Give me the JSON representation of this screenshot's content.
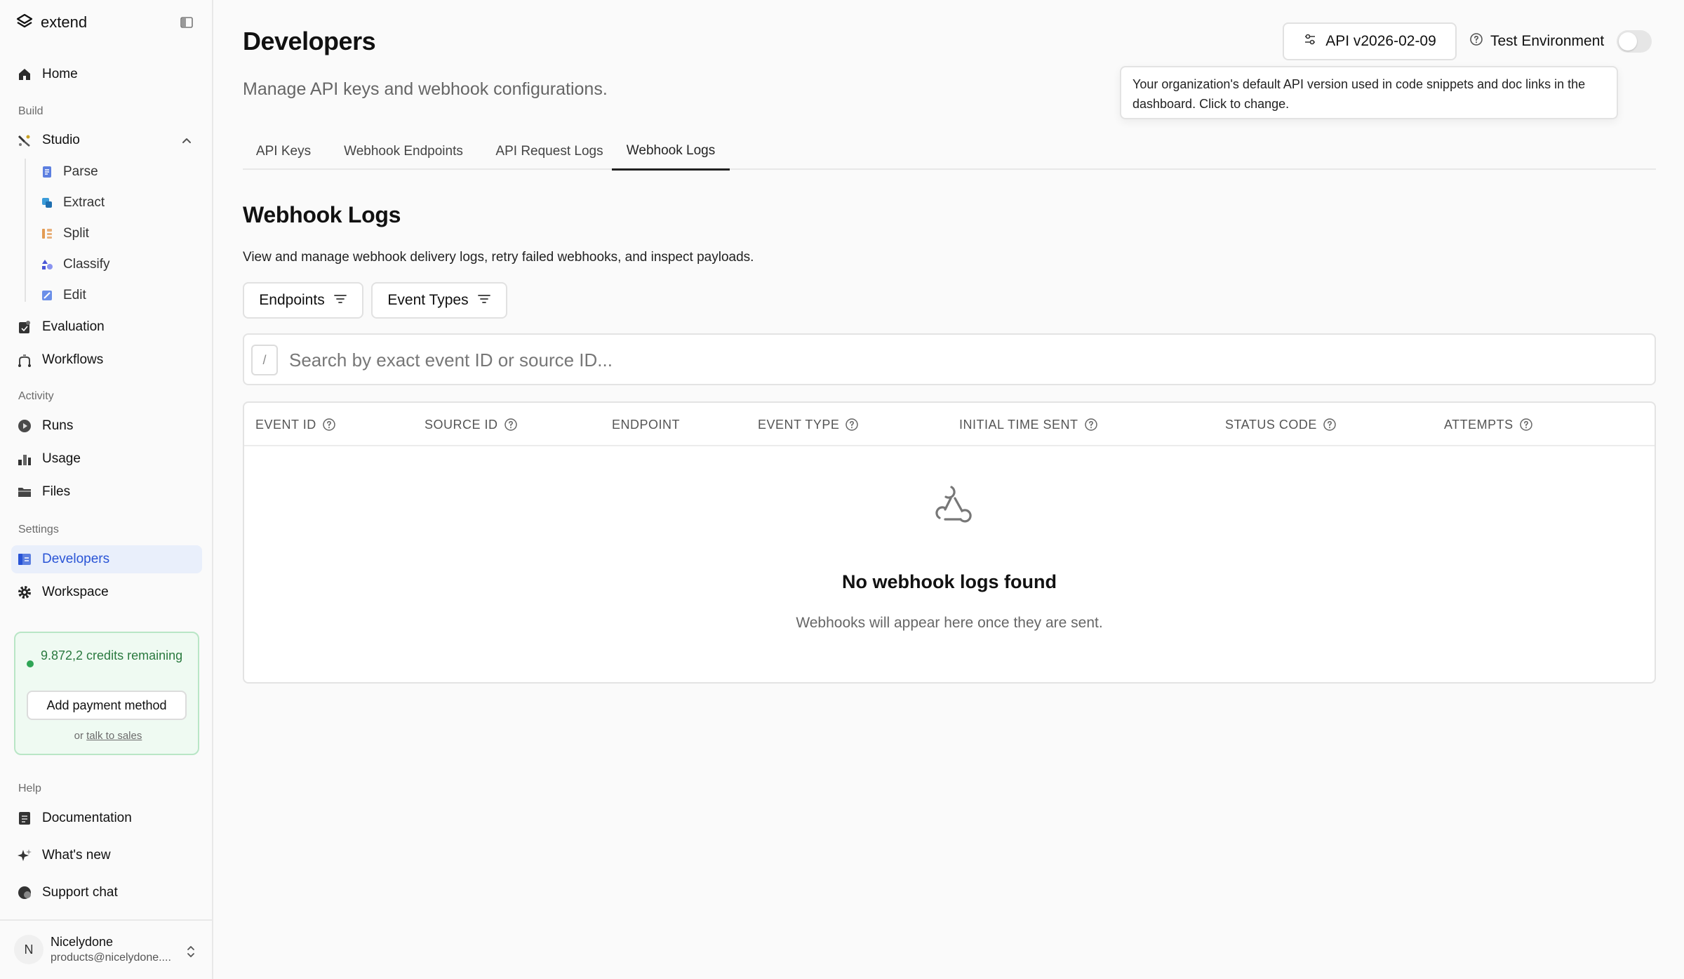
{
  "brand": {
    "name": "extend"
  },
  "sidebar": {
    "home": "Home",
    "sections": {
      "build": "Build",
      "activity": "Activity",
      "settings": "Settings",
      "help": "Help"
    },
    "studio": {
      "label": "Studio",
      "children": [
        "Parse",
        "Extract",
        "Split",
        "Classify",
        "Edit"
      ]
    },
    "evaluation": "Evaluation",
    "workflows": "Workflows",
    "runs": "Runs",
    "usage": "Usage",
    "files": "Files",
    "developers": "Developers",
    "workspace": "Workspace",
    "documentation": "Documentation",
    "whats_new": "What's new",
    "support_chat": "Support chat",
    "active_item": "Developers"
  },
  "credits": {
    "text": "9.872,2 credits remaining",
    "pay_button": "Add payment method",
    "talk_prefix": "or",
    "talk_link": "talk to sales"
  },
  "user": {
    "initial": "N",
    "name": "Nicelydone",
    "email": "products@nicelydone...."
  },
  "header": {
    "title": "Developers",
    "subtitle": "Manage API keys and webhook configurations.",
    "api_version": "API v2026-02-09",
    "env_label": "Test Environment",
    "env_enabled": false,
    "tooltip": "Your organization's default API version used in code snippets and doc links in the dashboard. Click to change."
  },
  "tabs": [
    "API Keys",
    "Webhook Endpoints",
    "API Request Logs",
    "Webhook Logs"
  ],
  "active_tab": "Webhook Logs",
  "webhook_logs": {
    "title": "Webhook Logs",
    "description": "View and manage webhook delivery logs, retry failed webhooks, and inspect payloads.",
    "filters": [
      "Endpoints",
      "Event Types"
    ],
    "search_key": "/",
    "search_placeholder": "Search by exact event ID or source ID...",
    "columns": [
      "EVENT ID",
      "SOURCE ID",
      "ENDPOINT",
      "EVENT TYPE",
      "INITIAL TIME SENT",
      "STATUS CODE",
      "ATTEMPTS"
    ],
    "empty_title": "No webhook logs found",
    "empty_subtitle": "Webhooks will appear here once they are sent."
  },
  "colors": {
    "accent": "#2954d6",
    "active_bg": "#e9effb",
    "credits_green": "#2a7a3f",
    "credits_bg": "#effaf2"
  }
}
